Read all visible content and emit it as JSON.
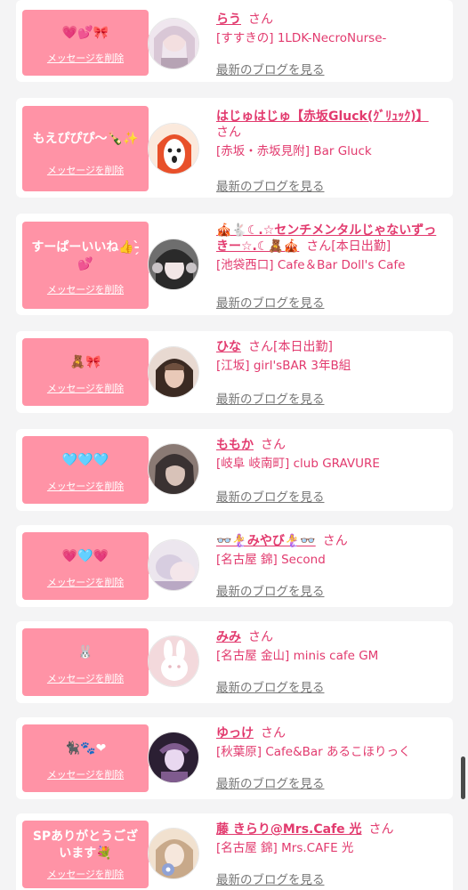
{
  "actions": {
    "delete_label": "メッセージを削除",
    "blog_label": "最新のブログを見る",
    "honorific": "さん"
  },
  "items": [
    {
      "message": "💗💕🎀",
      "name": "らう",
      "status": "",
      "shop": "[すすきの] 1LDK-NecroNurse-",
      "avatar_colors": [
        "#d9c7d6",
        "#b6a3b4",
        "#efe6ee"
      ]
    },
    {
      "message": "もえぴぴぴ〜🍾✨",
      "name": "はじゅはじゅ【赤坂Gluck(ｸﾞﾘｭｯｸ)】",
      "status": "",
      "shop": "[赤坂・赤坂見附] Bar Gluck",
      "avatar_colors": [
        "#f08a3c",
        "#ffffff",
        "#e8502a"
      ]
    },
    {
      "message": "すーぱーいいね👍-̗̀💕",
      "name": "🎪🐇☾.☆センチメンタルじゃないずっきー☆.☾🧸🎪",
      "status": "[本日出勤]",
      "shop": "[池袋西口] Cafe＆Bar Doll's Cafe",
      "avatar_colors": [
        "#2a2a2a",
        "#c9c4c7",
        "#6e6e6e"
      ]
    },
    {
      "message": "🧸🎀",
      "name": "ひな",
      "status": "[本日出勤]",
      "shop": "[江坂] girl'sBAR 3年B組",
      "avatar_colors": [
        "#6e4f3e",
        "#e9c9b8",
        "#3b2a22"
      ]
    },
    {
      "message": "🩵🩵🩵",
      "name": "ももか",
      "status": "",
      "shop": "[岐阜 岐南町] club GRAVURE",
      "avatar_colors": [
        "#3a3232",
        "#d8c2b8",
        "#8a7a74"
      ]
    },
    {
      "message": "💗🩵💗",
      "name": "👓🧜‍♀️みやび🧜‍♀️👓",
      "status": "",
      "shop": "[名古屋 錦] Second",
      "avatar_colors": [
        "#ece6ee",
        "#d7cde0",
        "#b9a8c4"
      ]
    },
    {
      "message": "🐰",
      "name": "みみ",
      "status": "",
      "shop": "[名古屋 金山] minis cafe GM",
      "avatar_colors": [
        "#f3d9dc",
        "#ffffff",
        "#e8b9c1"
      ]
    },
    {
      "message": "🐈‍⬛🐾❤",
      "name": "ゆっけ",
      "status": "",
      "shop": "[秋葉原] Cafe&Bar あるこほりっく",
      "avatar_colors": [
        "#2b1f33",
        "#7f5b8e",
        "#e9d8f0"
      ]
    },
    {
      "message": "SPありがとうございます💐",
      "name": "藤 きらり@Mrs.Cafe 光",
      "status": "",
      "shop": "[名古屋 錦] Mrs.CAFE 光",
      "avatar_colors": [
        "#c8a98a",
        "#f1e1cf",
        "#8fa2d6"
      ]
    }
  ]
}
